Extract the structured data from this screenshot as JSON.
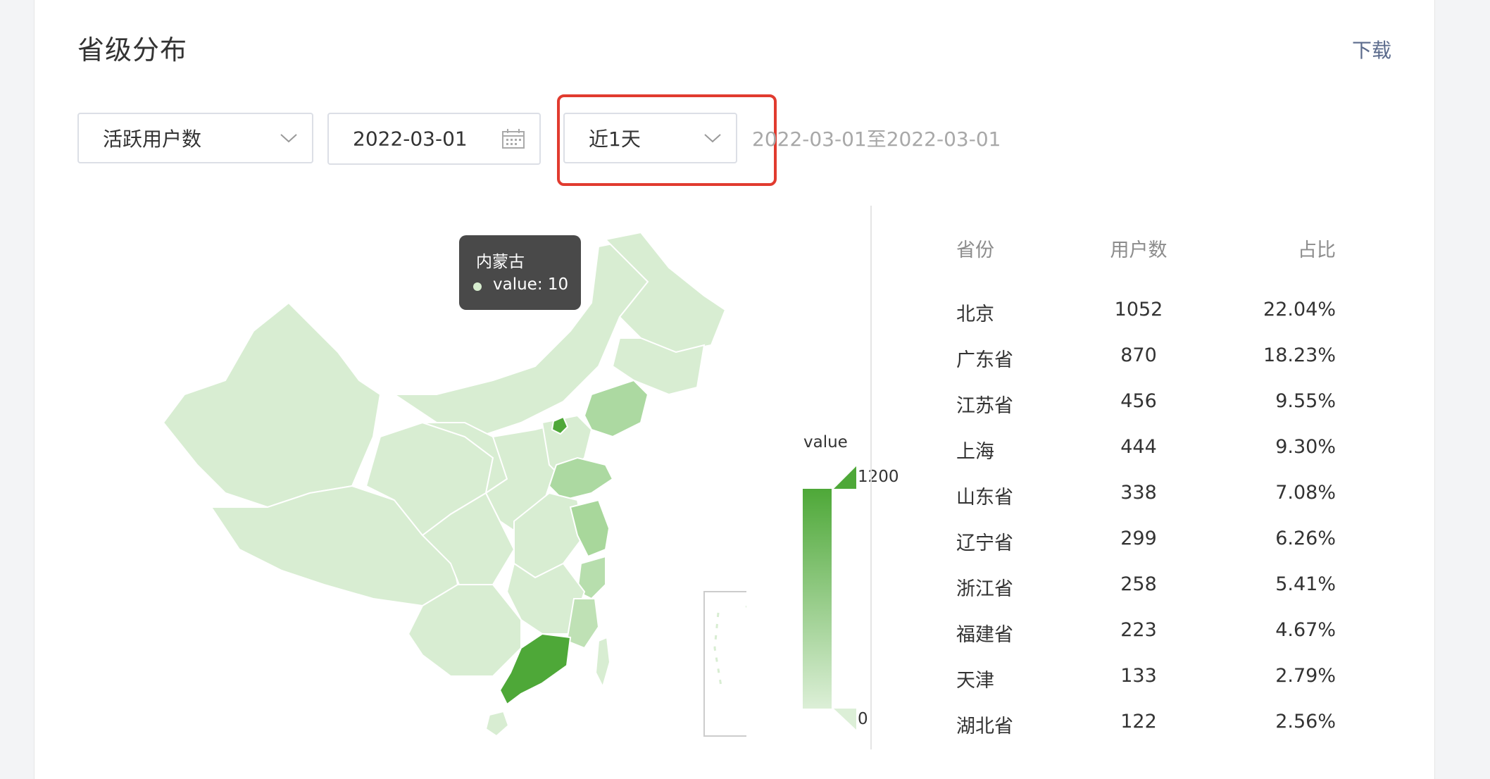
{
  "header": {
    "title": "省级分布",
    "download_label": "下载"
  },
  "filters": {
    "metric": "活跃用户数",
    "date": "2022-03-01",
    "range": "近1天",
    "range_text": "2022-03-01至2022-03-01"
  },
  "tooltip": {
    "region": "内蒙古",
    "label": "value:",
    "value": "10"
  },
  "legend": {
    "label": "value",
    "max": "1200",
    "min": "0",
    "color_low": "#dcefd7",
    "color_high": "#4ea838"
  },
  "table": {
    "headers": [
      "省份",
      "用户数",
      "占比"
    ],
    "rows": [
      [
        "北京",
        "1052",
        "22.04%"
      ],
      [
        "广东省",
        "870",
        "18.23%"
      ],
      [
        "江苏省",
        "456",
        "9.55%"
      ],
      [
        "上海",
        "444",
        "9.30%"
      ],
      [
        "山东省",
        "338",
        "7.08%"
      ],
      [
        "辽宁省",
        "299",
        "6.26%"
      ],
      [
        "浙江省",
        "258",
        "5.41%"
      ],
      [
        "福建省",
        "223",
        "4.67%"
      ],
      [
        "天津",
        "133",
        "2.79%"
      ],
      [
        "湖北省",
        "122",
        "2.56%"
      ]
    ]
  },
  "colors": {
    "accent_red": "#e13b2f",
    "link": "#5b6b8c"
  }
}
